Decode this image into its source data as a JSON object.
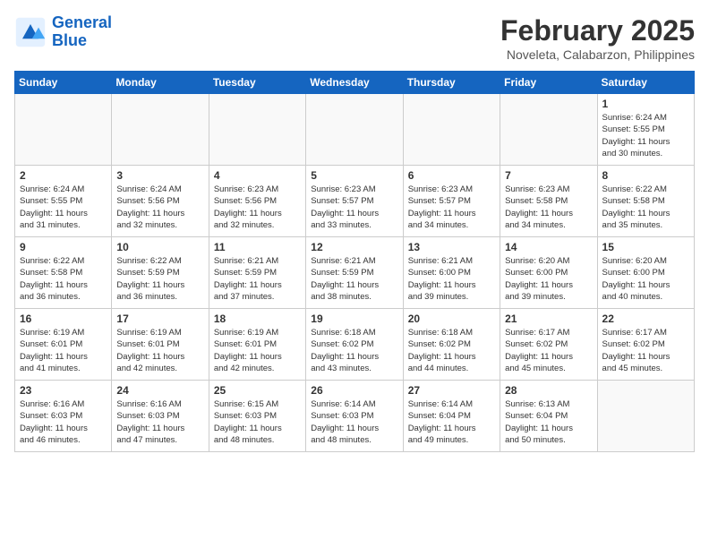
{
  "header": {
    "logo_line1": "General",
    "logo_line2": "Blue",
    "month_year": "February 2025",
    "location": "Noveleta, Calabarzon, Philippines"
  },
  "weekdays": [
    "Sunday",
    "Monday",
    "Tuesday",
    "Wednesday",
    "Thursday",
    "Friday",
    "Saturday"
  ],
  "weeks": [
    [
      {
        "day": "",
        "info": ""
      },
      {
        "day": "",
        "info": ""
      },
      {
        "day": "",
        "info": ""
      },
      {
        "day": "",
        "info": ""
      },
      {
        "day": "",
        "info": ""
      },
      {
        "day": "",
        "info": ""
      },
      {
        "day": "1",
        "info": "Sunrise: 6:24 AM\nSunset: 5:55 PM\nDaylight: 11 hours\nand 30 minutes."
      }
    ],
    [
      {
        "day": "2",
        "info": "Sunrise: 6:24 AM\nSunset: 5:55 PM\nDaylight: 11 hours\nand 31 minutes."
      },
      {
        "day": "3",
        "info": "Sunrise: 6:24 AM\nSunset: 5:56 PM\nDaylight: 11 hours\nand 32 minutes."
      },
      {
        "day": "4",
        "info": "Sunrise: 6:23 AM\nSunset: 5:56 PM\nDaylight: 11 hours\nand 32 minutes."
      },
      {
        "day": "5",
        "info": "Sunrise: 6:23 AM\nSunset: 5:57 PM\nDaylight: 11 hours\nand 33 minutes."
      },
      {
        "day": "6",
        "info": "Sunrise: 6:23 AM\nSunset: 5:57 PM\nDaylight: 11 hours\nand 34 minutes."
      },
      {
        "day": "7",
        "info": "Sunrise: 6:23 AM\nSunset: 5:58 PM\nDaylight: 11 hours\nand 34 minutes."
      },
      {
        "day": "8",
        "info": "Sunrise: 6:22 AM\nSunset: 5:58 PM\nDaylight: 11 hours\nand 35 minutes."
      }
    ],
    [
      {
        "day": "9",
        "info": "Sunrise: 6:22 AM\nSunset: 5:58 PM\nDaylight: 11 hours\nand 36 minutes."
      },
      {
        "day": "10",
        "info": "Sunrise: 6:22 AM\nSunset: 5:59 PM\nDaylight: 11 hours\nand 36 minutes."
      },
      {
        "day": "11",
        "info": "Sunrise: 6:21 AM\nSunset: 5:59 PM\nDaylight: 11 hours\nand 37 minutes."
      },
      {
        "day": "12",
        "info": "Sunrise: 6:21 AM\nSunset: 5:59 PM\nDaylight: 11 hours\nand 38 minutes."
      },
      {
        "day": "13",
        "info": "Sunrise: 6:21 AM\nSunset: 6:00 PM\nDaylight: 11 hours\nand 39 minutes."
      },
      {
        "day": "14",
        "info": "Sunrise: 6:20 AM\nSunset: 6:00 PM\nDaylight: 11 hours\nand 39 minutes."
      },
      {
        "day": "15",
        "info": "Sunrise: 6:20 AM\nSunset: 6:00 PM\nDaylight: 11 hours\nand 40 minutes."
      }
    ],
    [
      {
        "day": "16",
        "info": "Sunrise: 6:19 AM\nSunset: 6:01 PM\nDaylight: 11 hours\nand 41 minutes."
      },
      {
        "day": "17",
        "info": "Sunrise: 6:19 AM\nSunset: 6:01 PM\nDaylight: 11 hours\nand 42 minutes."
      },
      {
        "day": "18",
        "info": "Sunrise: 6:19 AM\nSunset: 6:01 PM\nDaylight: 11 hours\nand 42 minutes."
      },
      {
        "day": "19",
        "info": "Sunrise: 6:18 AM\nSunset: 6:02 PM\nDaylight: 11 hours\nand 43 minutes."
      },
      {
        "day": "20",
        "info": "Sunrise: 6:18 AM\nSunset: 6:02 PM\nDaylight: 11 hours\nand 44 minutes."
      },
      {
        "day": "21",
        "info": "Sunrise: 6:17 AM\nSunset: 6:02 PM\nDaylight: 11 hours\nand 45 minutes."
      },
      {
        "day": "22",
        "info": "Sunrise: 6:17 AM\nSunset: 6:02 PM\nDaylight: 11 hours\nand 45 minutes."
      }
    ],
    [
      {
        "day": "23",
        "info": "Sunrise: 6:16 AM\nSunset: 6:03 PM\nDaylight: 11 hours\nand 46 minutes."
      },
      {
        "day": "24",
        "info": "Sunrise: 6:16 AM\nSunset: 6:03 PM\nDaylight: 11 hours\nand 47 minutes."
      },
      {
        "day": "25",
        "info": "Sunrise: 6:15 AM\nSunset: 6:03 PM\nDaylight: 11 hours\nand 48 minutes."
      },
      {
        "day": "26",
        "info": "Sunrise: 6:14 AM\nSunset: 6:03 PM\nDaylight: 11 hours\nand 48 minutes."
      },
      {
        "day": "27",
        "info": "Sunrise: 6:14 AM\nSunset: 6:04 PM\nDaylight: 11 hours\nand 49 minutes."
      },
      {
        "day": "28",
        "info": "Sunrise: 6:13 AM\nSunset: 6:04 PM\nDaylight: 11 hours\nand 50 minutes."
      },
      {
        "day": "",
        "info": ""
      }
    ]
  ]
}
